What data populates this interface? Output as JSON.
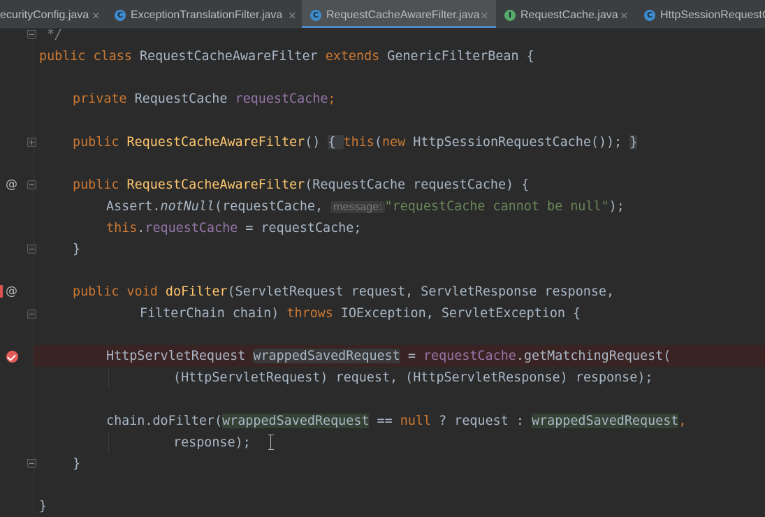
{
  "tabs": [
    {
      "label": "ecurityConfig.java",
      "close": "×",
      "icon": "class-icon",
      "active": false
    },
    {
      "label": "ExceptionTranslationFilter.java",
      "close": "×",
      "icon": "class-icon",
      "active": false
    },
    {
      "label": "RequestCacheAwareFilter.java",
      "close": "×",
      "icon": "class-icon",
      "active": true
    },
    {
      "label": "RequestCache.java",
      "close": "×",
      "icon": "interface-icon",
      "active": false
    },
    {
      "label": "HttpSessionRequestC",
      "close": "",
      "icon": "class-icon",
      "active": false
    }
  ],
  "tab_icon_letters": {
    "class": "C",
    "interface": "I"
  },
  "gutter": {
    "at_marker": "@"
  },
  "colors": {
    "background": "#2b2b2b",
    "keyword": "#cc7832",
    "field": "#9876aa",
    "method": "#ffc66d",
    "string": "#6a8759",
    "default_text": "#a9b7c6",
    "tab_underline": "#4a88c7"
  },
  "code": {
    "l1": {
      "comment": " */"
    },
    "l2": {
      "kw1": "public",
      "kw2": "class",
      "name": "RequestCacheAwareFilter",
      "kw3": "extends",
      "rest": " GenericFilterBean {"
    },
    "l3": {
      "kw": "private",
      "type": " RequestCache ",
      "fld": "requestCache",
      "end": ";"
    },
    "l4": {
      "kw": "public",
      "fn": "RequestCacheAwareFilter",
      "paren": "()",
      "ob": "{",
      "kw2": "this",
      "a": "(",
      "kw3": "new",
      "b": " HttpSessionRequestCache());",
      "cb": "}"
    },
    "l5": {
      "kw": "public",
      "fn": "RequestCacheAwareFilter",
      "rest": "(RequestCache requestCache) {"
    },
    "l6": {
      "a": "Assert.",
      "fn": "notNull",
      "b": "(requestCache, ",
      "hint": "message:",
      "str": "\"requestCache cannot be null\"",
      "c": ");"
    },
    "l7": {
      "kw": "this",
      "dot": ".",
      "fld": "requestCache",
      "rest": " = requestCache;"
    },
    "l8": {
      "brace": "}"
    },
    "l9": {
      "kw1": "public",
      "kw2": "void",
      "fn": "doFilter",
      "rest": "(ServletRequest request, ServletResponse response,"
    },
    "l10": {
      "a": "FilterChain chain) ",
      "kw": "throws",
      "rest": " IOException, ServletException {"
    },
    "l11": {
      "a": "HttpServletRequest ",
      "var": "wrappedSavedRequest",
      "b": " = ",
      "fld": "requestCache",
      "c": ".getMatchingRequest("
    },
    "l12": {
      "text": "(HttpServletRequest) request, (HttpServletResponse) response);"
    },
    "l13": {
      "a": "chain.doFilter(",
      "var1": "wrappedSavedRequest",
      "b": " == ",
      "kw": "null",
      "c": " ? request : ",
      "var2": "wrappedSavedRequest",
      "d": ","
    },
    "l14": {
      "text": "response);"
    },
    "l15": {
      "brace": "}"
    },
    "l16": {
      "brace": "}"
    }
  }
}
